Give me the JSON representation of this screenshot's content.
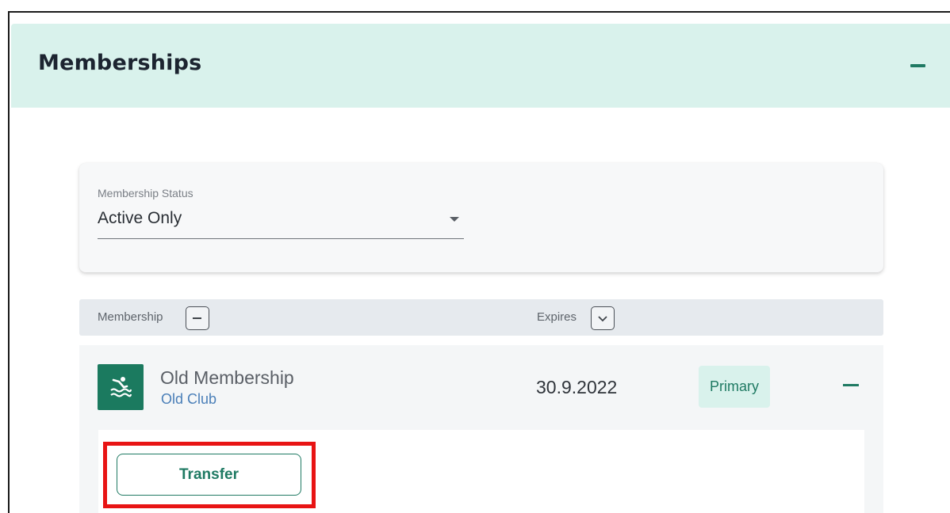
{
  "section": {
    "title": "Memberships",
    "collapse_icon": "minus-icon"
  },
  "filter": {
    "label": "Membership Status",
    "value": "Active Only",
    "caret_icon": "caret-down-icon"
  },
  "table": {
    "columns": [
      {
        "label": "Membership",
        "control_icon": "minus-box-icon"
      },
      {
        "label": "Expires",
        "control_icon": "chevron-down-box-icon"
      }
    ],
    "rows": [
      {
        "icon": "swimming-icon",
        "title": "Old Membership",
        "subtitle": "Old Club",
        "expires": "30.9.2022",
        "badge": "Primary",
        "collapse_icon": "minus-icon",
        "actions": {
          "transfer_label": "Transfer"
        }
      }
    ]
  },
  "colors": {
    "accent": "#1f7a63",
    "header_bg": "#d9f2ec",
    "highlight": "#e81414",
    "link": "#4a7fb8"
  }
}
